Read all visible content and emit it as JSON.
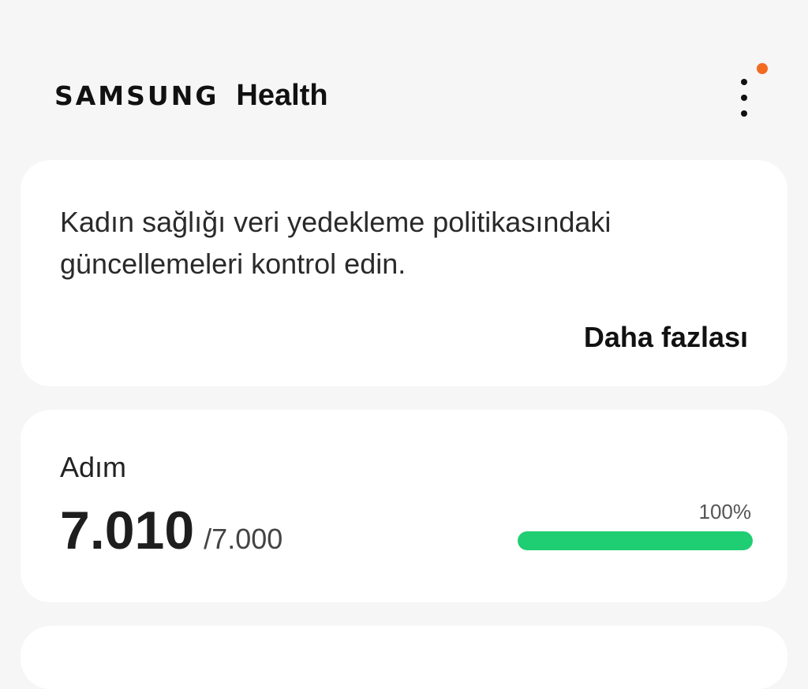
{
  "header": {
    "brand_samsung": "SAMSUNG",
    "brand_health": "Health",
    "more_icon": "more-vertical-icon",
    "notification_color": "#f26b21"
  },
  "notice_card": {
    "message": "Kadın sağlığı veri yedekleme politikasındaki güncellemeleri kontrol edin.",
    "more_link": "Daha fazlası"
  },
  "steps_card": {
    "title": "Adım",
    "count": "7.010",
    "goal": "/7.000",
    "progress_label": "100%",
    "progress_fraction": 1.0,
    "progress_color": "#1fcd73"
  }
}
